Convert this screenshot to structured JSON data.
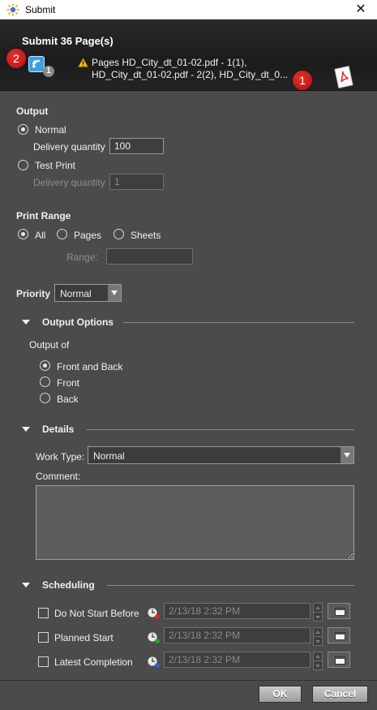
{
  "window": {
    "title": "Submit",
    "close_glyph": "✕"
  },
  "header": {
    "heading": "Submit 36 Page(s)",
    "job_count": "1",
    "badge_left": "2",
    "badge_right": "1",
    "pages_line1": "Pages HD_City_dt_01-02.pdf - 1(1),",
    "pages_line2": "HD_City_dt_01-02.pdf - 2(2), HD_City_dt_0...",
    "icons": [
      "app-icon",
      "job-icon",
      "warning-icon",
      "pdf-icon"
    ]
  },
  "output": {
    "title": "Output",
    "normal_label": "Normal",
    "normal_qty_label": "Delivery quantity",
    "normal_qty": "100",
    "test_label": "Test Print",
    "test_qty_label": "Delivery quantity",
    "test_qty": "1",
    "selected": "Normal"
  },
  "print_range": {
    "title": "Print Range",
    "all": "All",
    "pages": "Pages",
    "sheets": "Sheets",
    "range_label": "Range:",
    "range_value": "",
    "selected": "All"
  },
  "priority": {
    "label": "Priority",
    "value": "Normal"
  },
  "output_options": {
    "title": "Output Options",
    "output_of_label": "Output of",
    "front_back": "Front and Back",
    "front": "Front",
    "back": "Back",
    "selected": "Front and Back"
  },
  "details": {
    "title": "Details",
    "work_type_label": "Work Type:",
    "work_type_value": "Normal",
    "comment_label": "Comment:",
    "comment_value": ""
  },
  "scheduling": {
    "title": "Scheduling",
    "rows": [
      {
        "label": "Do Not Start Before",
        "value": "2/13/18 2:32 PM",
        "checked": false
      },
      {
        "label": "Planned Start",
        "value": "2/13/18 2:32 PM",
        "checked": false
      },
      {
        "label": "Latest Completion",
        "value": "2/13/18 2:32 PM",
        "checked": false
      }
    ]
  },
  "buttons": {
    "ok": "OK",
    "cancel": "Cancel"
  },
  "colors": {
    "background": "#4b4b4c",
    "header": "#1f1f20",
    "badge": "#c81c18",
    "accent": "#3aa0e0"
  }
}
